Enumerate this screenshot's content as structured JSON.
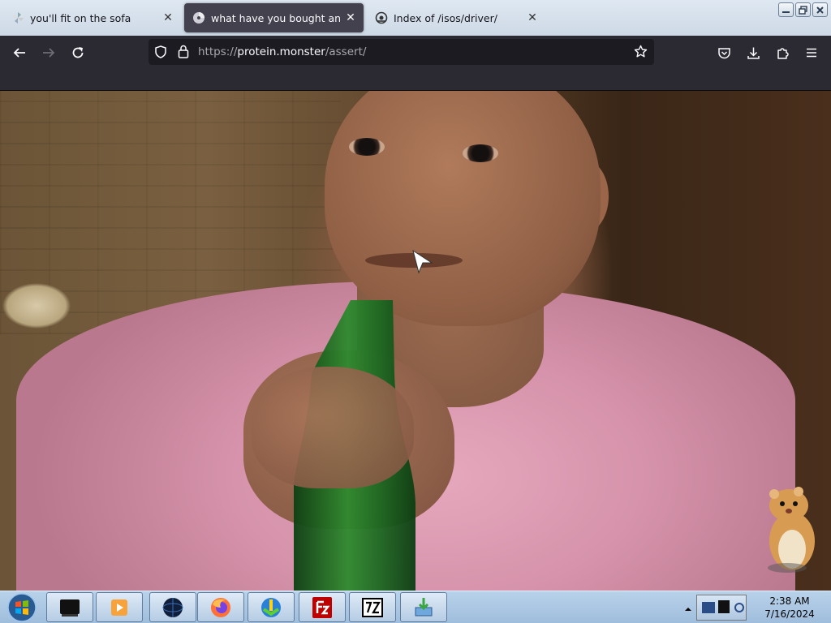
{
  "browser": {
    "tabs": [
      {
        "label": "you'll fit on the sofa",
        "icon": "pinwheel-icon",
        "active": false
      },
      {
        "label": "what have you bought and sold",
        "icon": "disc-icon",
        "active": true
      },
      {
        "label": "Index of /isos/driver/",
        "icon": "cloud-gear-icon",
        "active": false
      }
    ],
    "tab_close_glyph": "✕",
    "url": {
      "scheme": "https://",
      "host": "protein.monster",
      "path": "/assert/"
    }
  },
  "taskbar": {
    "apps": [
      "terminal-icon",
      "media-player-icon",
      "globe-icon",
      "firefox-icon",
      "download-manager-icon",
      "filezilla-icon",
      "7zip-icon",
      "installer-icon"
    ],
    "clock": {
      "time": "2:38 AM",
      "date": "7/16/2024"
    }
  },
  "colors": {
    "tab_active": "#42414d",
    "toolbar": "#2b2a33",
    "urlbar": "#1c1b22"
  }
}
